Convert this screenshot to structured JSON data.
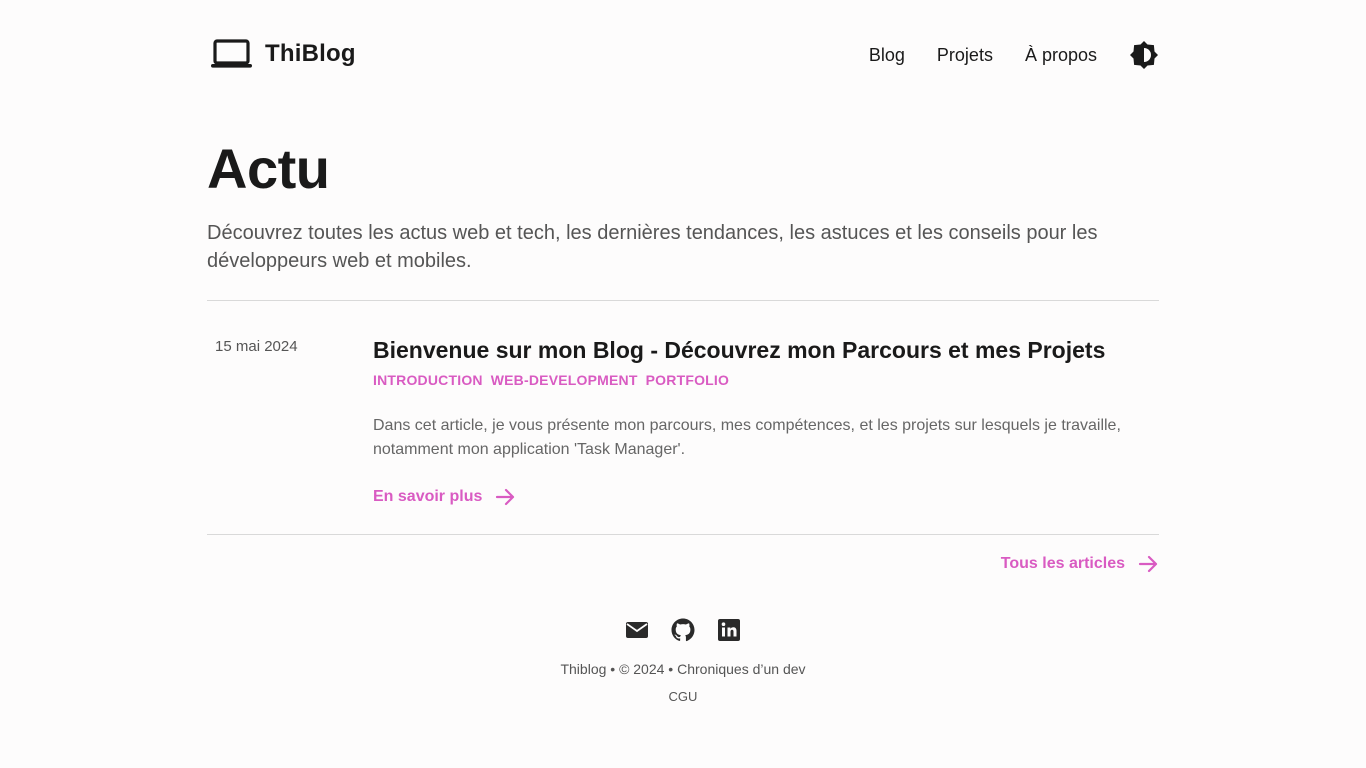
{
  "header": {
    "brand": "ThiBlog",
    "nav": [
      {
        "label": "Blog"
      },
      {
        "label": "Projets"
      },
      {
        "label": "À propos"
      }
    ]
  },
  "hero": {
    "title": "Actu",
    "lead": "Découvrez toutes les actus web et tech, les dernières tendances, les astuces et les conseils pour les développeurs web et mobiles."
  },
  "articles": [
    {
      "date": "15 mai 2024",
      "title": "Bienvenue sur mon Blog - Découvrez mon Parcours et mes Projets",
      "tags": [
        "INTRODUCTION",
        "WEB-DEVELOPMENT",
        "PORTFOLIO"
      ],
      "excerpt": "Dans cet article, je vous présente mon parcours, mes compétences, et les projets sur lesquels je travaille, notamment mon application 'Task Manager'.",
      "more_label": "En savoir plus"
    }
  ],
  "all_articles_label": "Tous les articles",
  "footer": {
    "socials": [
      "mail-icon",
      "github-icon",
      "linkedin-icon"
    ],
    "line": "Thiblog • © 2024 • Chroniques d’un dev",
    "cgu": "CGU"
  },
  "colors": {
    "accent": "#d95bc2",
    "text": "#1a1a1a",
    "muted": "#555555",
    "background": "#fdfcfc"
  }
}
